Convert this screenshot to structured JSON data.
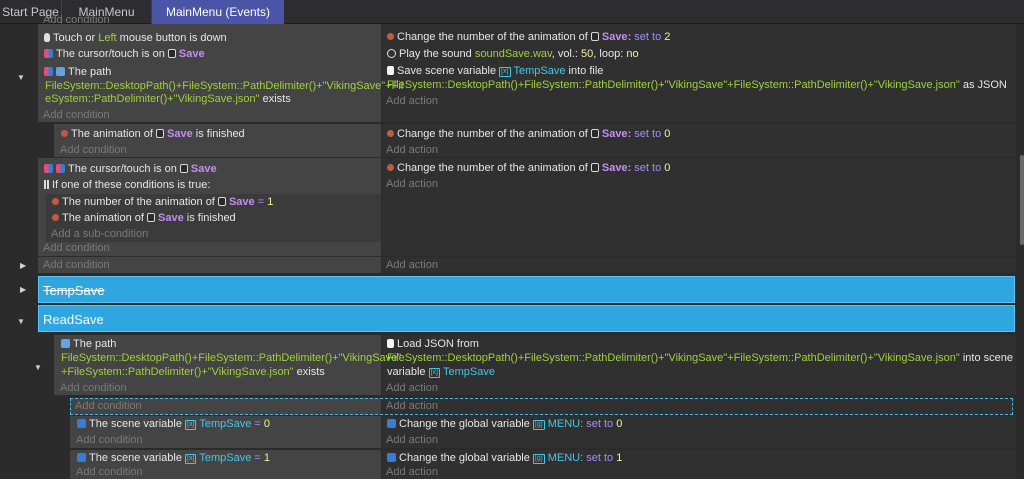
{
  "tabs": [
    {
      "label": "Start Page"
    },
    {
      "label": "MainMenu"
    },
    {
      "label": "MainMenu (Events)"
    }
  ],
  "common": {
    "add_condition": "Add condition",
    "add_action": "Add action",
    "add_subcondition": "Add a sub-condition"
  },
  "event1": {
    "c1": {
      "a": "Touch or ",
      "b": "Left",
      "c": " mouse button is down"
    },
    "c2": {
      "a": "The cursor/touch is on ",
      "obj": "Save"
    },
    "c3": {
      "a": "The path"
    },
    "c3_path1": "FileSystem::DesktopPath()+FileSystem::PathDelimiter()+\"VikingSave\"+Fil",
    "c3_path2": "eSystem::PathDelimiter()+\"VikingSave.json\"",
    "c3_exists": " exists",
    "a1": {
      "a": "Change the number of the animation of ",
      "obj": "Save",
      "colon": ":",
      "op": " set to ",
      "val": "2"
    },
    "a2": {
      "a": "Play the sound ",
      "file": "soundSave.wav",
      "b": ", vol.: ",
      "vol": "50",
      "c": ", loop: ",
      "loop": "no"
    },
    "a3": {
      "a": "Save scene variable ",
      "var": "TempSave",
      "b": " into file"
    },
    "a3_path": "FileSystem::DesktopPath()+FileSystem::PathDelimiter()+\"VikingSave\"+FileSystem::PathDelimiter()+\"VikingSave.json\"",
    "a3_json": " as JSON"
  },
  "event2": {
    "c1": {
      "a": "The animation of ",
      "obj": "Save",
      "b": " is finished"
    },
    "a1": {
      "a": "Change the number of the animation of ",
      "obj": "Save",
      "colon": ":",
      "op": " set to ",
      "val": "0"
    }
  },
  "event3": {
    "c1": {
      "a": "The cursor/touch is on ",
      "obj": "Save"
    },
    "c2": "If one of these conditions is true:",
    "s1": {
      "a": "The number of the animation of ",
      "obj": "Save",
      "op": " = ",
      "val": "1"
    },
    "s2": {
      "a": "The animation of ",
      "obj": "Save",
      "b": " is finished"
    },
    "a1": {
      "a": "Change the number of the animation of ",
      "obj": "Save",
      "colon": ":",
      "op": " set to ",
      "val": "0"
    }
  },
  "groups": {
    "g1": "TempSave",
    "g2": "ReadSave"
  },
  "event4": {
    "c1": "The path",
    "c1_path1": "FileSystem::DesktopPath()+FileSystem::PathDelimiter()+\"VikingSave\"",
    "c1_path2": "+FileSystem::PathDelimiter()+\"VikingSave.json\"",
    "c1_exists": " exists",
    "a1": "Load JSON from",
    "a1_path": "FileSystem::DesktopPath()+FileSystem::PathDelimiter()+\"VikingSave\"+FileSystem::PathDelimiter()+\"VikingSave.json\"",
    "a1_b": " into scene",
    "a1_c": "variable ",
    "a1_var": "TempSave"
  },
  "event5": {
    "c1": {
      "a": "The scene variable ",
      "var": "TempSave",
      "op": " = ",
      "val": "0"
    },
    "a1": {
      "a": "Change the global variable ",
      "var": "MENU",
      "colon": ":",
      "op": " set to ",
      "val": "0"
    }
  },
  "event6": {
    "c1": {
      "a": "The scene variable ",
      "var": "TempSave",
      "op": " = ",
      "val": "1"
    },
    "a1": {
      "a": "Change the global variable ",
      "var": "MENU",
      "colon": ":",
      "op": " set to ",
      "val": "1"
    }
  },
  "icons": [
    "mouse-icon",
    "cursor-icon",
    "path-icon",
    "animation-icon",
    "sound-icon",
    "file-icon",
    "variable-icon",
    "or-icon",
    "arrow-down-icon",
    "arrow-right-icon"
  ]
}
